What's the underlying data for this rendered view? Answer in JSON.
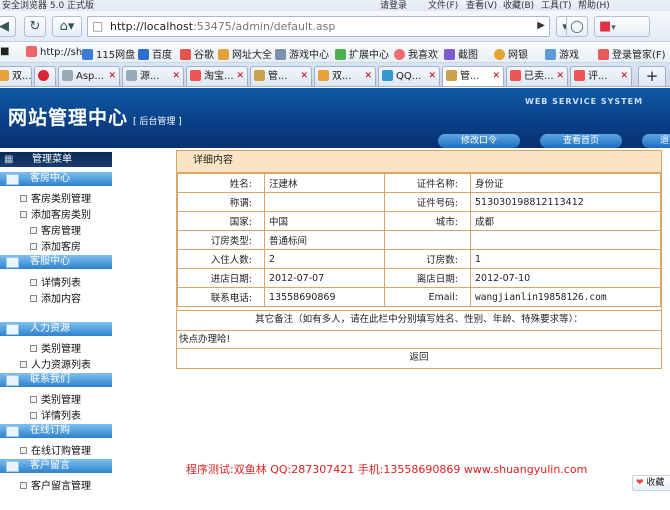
{
  "browser": {
    "title": "安全浏览器 5.0 正式版",
    "account": "请登录",
    "menu": [
      "文件(F)",
      "查看(V)",
      "收藏(B)",
      "工具(T)",
      "帮助(H)"
    ],
    "url_host": "http://localhost",
    "url_path": ":53475/admin/default.asp",
    "favorites": [
      "http://sh",
      "115网盘",
      "百度",
      "谷歌",
      "网址大全",
      "游戏中心",
      "扩展中心",
      "我喜欢",
      "截图",
      "网银",
      "游戏",
      "登录管家(F)"
    ],
    "tabs": [
      "双...",
      "",
      "Asp...",
      "源...",
      "淘宝...",
      "管...",
      "双...",
      "QQ...",
      "管...",
      "已卖...",
      "评..."
    ],
    "icons": [
      "back-icon",
      "refresh-icon",
      "home-icon",
      "shield-icon",
      "search-icon"
    ]
  },
  "header": {
    "title": "网站管理中心",
    "subtitle": "[ 后台管理 ]",
    "tagline": "WEB SERVICE SYSTEM",
    "nav": [
      "修改口令",
      "查看首页",
      "退"
    ]
  },
  "sidebar": {
    "menu_title": "管理菜单",
    "sections": [
      {
        "title": "客房中心",
        "items": [
          "客房类别管理",
          "添加客房类别",
          "客房管理",
          "添加客房"
        ]
      },
      {
        "title": "客服中心",
        "items": [
          "详情列表",
          "添加内容"
        ]
      },
      {
        "title": "人力资源",
        "items": [
          "类别管理",
          "人力资源列表"
        ]
      },
      {
        "title": "联系我们",
        "items": [
          "类别管理",
          "详情列表"
        ]
      },
      {
        "title": "在线订购",
        "items": [
          "在线订购管理"
        ]
      },
      {
        "title": "客户留言",
        "items": [
          "客户留言管理"
        ]
      }
    ]
  },
  "detail": {
    "heading": "详细内容",
    "rows": [
      {
        "l1": "姓名:",
        "v1": "汪建林",
        "l2": "证件名称:",
        "v2": "身份证"
      },
      {
        "l1": "称谓:",
        "v1": "",
        "l2": "证件号码:",
        "v2": "513030198812113412"
      },
      {
        "l1": "国家:",
        "v1": "中国",
        "l2": "城市:",
        "v2": "成都"
      },
      {
        "l1": "订房类型:",
        "v1": "普通标间",
        "l2": "",
        "v2": ""
      },
      {
        "l1": "入住人数:",
        "v1": "2",
        "l2": "订房数:",
        "v2": "1"
      },
      {
        "l1": "进店日期:",
        "v1": "2012-07-07",
        "l2": "离店日期:",
        "v2": "2012-07-10"
      },
      {
        "l1": "联系电话:",
        "v1": "13558690869",
        "l2": "Email:",
        "v2": "wangjianlin19858126.com"
      }
    ],
    "remark_label": "其它备注（如有多人，请在此栏中分别填写姓名、性别、年龄、特殊要求等）：",
    "remark_value": "快点办理哈!",
    "back_label": "返回"
  },
  "footer": "程序测试:双鱼林 QQ:287307421 手机:13558690869 www.shuangyulin.com",
  "favorite_button": "收藏",
  "colors": {
    "banner": "#0a3f86",
    "table_border": "#d9a66a",
    "table_header": "#fbe4c4",
    "footer_text": "#e02020"
  }
}
